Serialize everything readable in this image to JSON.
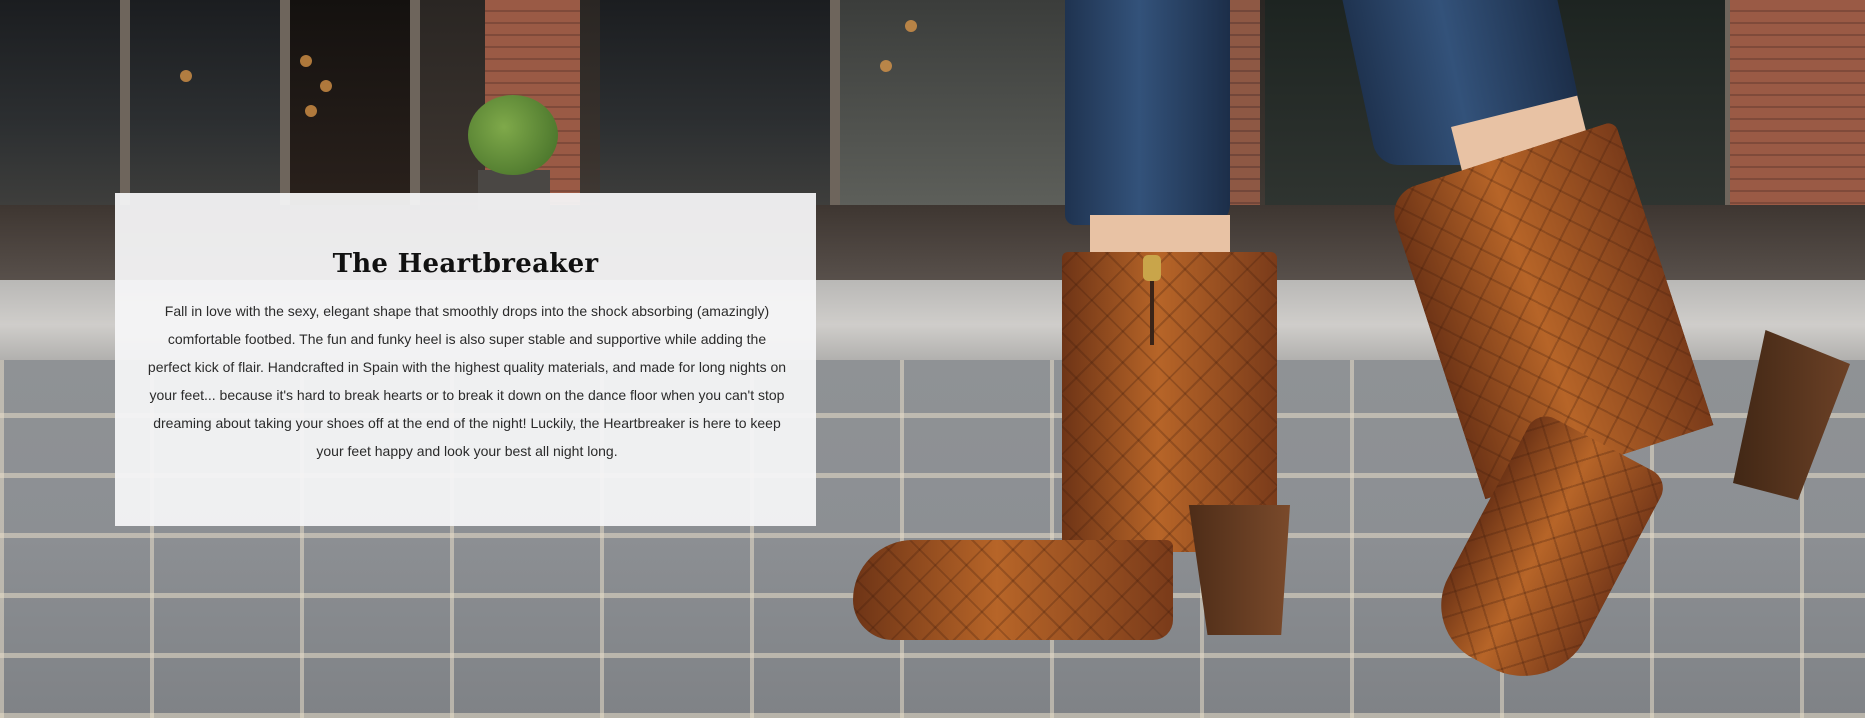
{
  "hero": {
    "image": "Brown croc-embossed ankle boots with block heels worn with skinny jeans on a cobblestone street",
    "card": {
      "title": "The Heartbreaker",
      "body": "Fall in love with the sexy, elegant shape that smoothly drops into the shock absorbing (amazingly) comfortable footbed. The fun and funky heel is also super stable and supportive while adding the perfect kick of flair. Handcrafted in Spain with the highest quality materials, and made for long nights on your feet... because it's hard to break hearts or to break it down on the dance floor when you can't stop dreaming about taking your shoes off at the end of the night! Luckily, the Heartbreaker is here to keep your feet happy and look your best all night long."
    }
  },
  "colors": {
    "card_background": "#f5f5f6",
    "title": "#111111",
    "body_text": "#2b2b2b",
    "boot_leather": "#9a4f22"
  }
}
